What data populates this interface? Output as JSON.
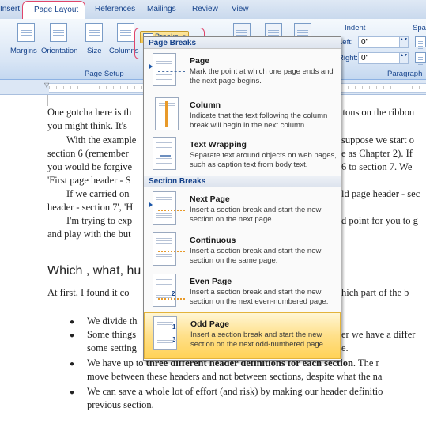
{
  "tabs": [
    "Insert",
    "Page Layout",
    "References",
    "Mailings",
    "Review",
    "View"
  ],
  "ribbon": {
    "buttons": [
      "Margins",
      "Orientation",
      "Size",
      "Columns"
    ],
    "breaks_label": "Breaks",
    "group_page_setup": "Page Setup",
    "indent_label": "Indent",
    "left_label": "Left:",
    "right_label": "Right:",
    "left_value": "0\"",
    "right_value": "0\"",
    "spacing_label": "Spa",
    "paragraph_label": "Paragraph"
  },
  "menu": {
    "page_breaks_header": "Page Breaks",
    "section_breaks_header": "Section Breaks",
    "items": [
      {
        "title": "Page",
        "desc": "Mark the point at which one page ends and the next page begins."
      },
      {
        "title": "Column",
        "desc": "Indicate that the text following the column break will begin in the next column."
      },
      {
        "title": "Text Wrapping",
        "desc": "Separate text around objects on web pages, such as caption text from body text."
      },
      {
        "title": "Next Page",
        "desc": "Insert a section break and start the new section on the next page."
      },
      {
        "title": "Continuous",
        "desc": "Insert a section break and start the new section on the same page."
      },
      {
        "title": "Even Page",
        "desc": "Insert a section break and start the new section on the next even-numbered page."
      },
      {
        "title": "Odd Page",
        "desc": "Insert a section break and start the new section on the next odd-numbered page."
      }
    ]
  },
  "doc": {
    "lines": [
      "One gotcha here is th",
      "you might think. It's",
      "With the example",
      "section 6 (remember",
      "you would be forgive",
      "'First page header - S",
      "If we carried on",
      "header - section 7', 'H",
      "I'm trying to exp",
      "and play with the but",
      "At first, I found it co",
      "We divide th",
      "Some things",
      "some setting",
      "We have up to",
      "move between these headers and not between sections, despite what the na",
      "We can save a whole lot of effort (and risk) by making our header definitio",
      "previous section."
    ],
    "right_lines": [
      "ttons on the ribbon",
      "suppose we start o",
      "e as Chapter 2). If",
      "6 to section 7. We",
      "ld page header - sec",
      "d point for you to g",
      "hich part of the b",
      "er we have a differ",
      "e."
    ],
    "bold_text": "three different header definitions for each section",
    "heading": "Which , what, hu",
    "end_text": ". The r"
  }
}
